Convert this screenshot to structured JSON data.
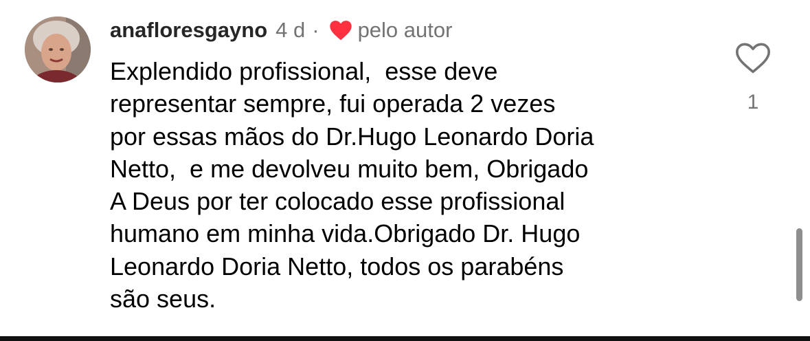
{
  "comment": {
    "username": "anafloresgayno",
    "time_ago": "4 d",
    "separator": "·",
    "liked_by_author_label": "pelo autor",
    "text": "Explendido profissional,  esse deve\nrepresentar sempre, fui operada 2 vezes\npor essas mãos do Dr.Hugo Leonardo Doria\nNetto,  e me devolveu muito bem, Obrigado\nA Deus por ter colocado esse profissional\nhumano em minha vida.Obrigado Dr. Hugo\nLeonardo Doria Netto, todos os parabéns\nsão seus.",
    "like_count": "1"
  },
  "icons": {
    "author_heart": "heart-filled-icon",
    "like_button": "heart-outline-icon"
  },
  "colors": {
    "author_heart": "#ff3040",
    "meta_text": "#737373",
    "username": "#262626"
  }
}
